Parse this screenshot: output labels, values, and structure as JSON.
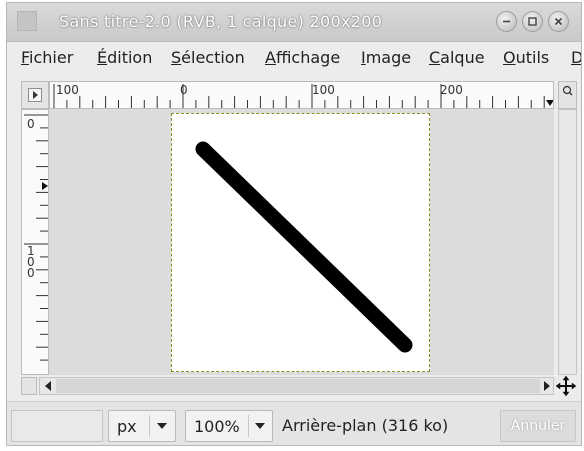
{
  "window": {
    "title": "Sans titre-2.0 (RVB, 1 calque) 200x200"
  },
  "menubar": {
    "items": [
      {
        "label": "Fichier"
      },
      {
        "label": "Édition"
      },
      {
        "label": "Sélection"
      },
      {
        "label": "Affichage"
      },
      {
        "label": "Image"
      },
      {
        "label": "Calque"
      },
      {
        "label": "Outils"
      },
      {
        "label": "D"
      }
    ]
  },
  "rulers": {
    "horizontal_labels": [
      "100",
      "0",
      "100",
      "200"
    ],
    "vertical_labels": [
      "0",
      "100"
    ]
  },
  "statusbar": {
    "unit": "px",
    "zoom": "100%",
    "layer_info": "Arrière-plan (316 ko)",
    "cancel_label": "Annuler"
  },
  "colors": {
    "brush_stroke": "#000000",
    "canvas_background": "#ffffff",
    "selection_border": "#8a8a1e"
  }
}
